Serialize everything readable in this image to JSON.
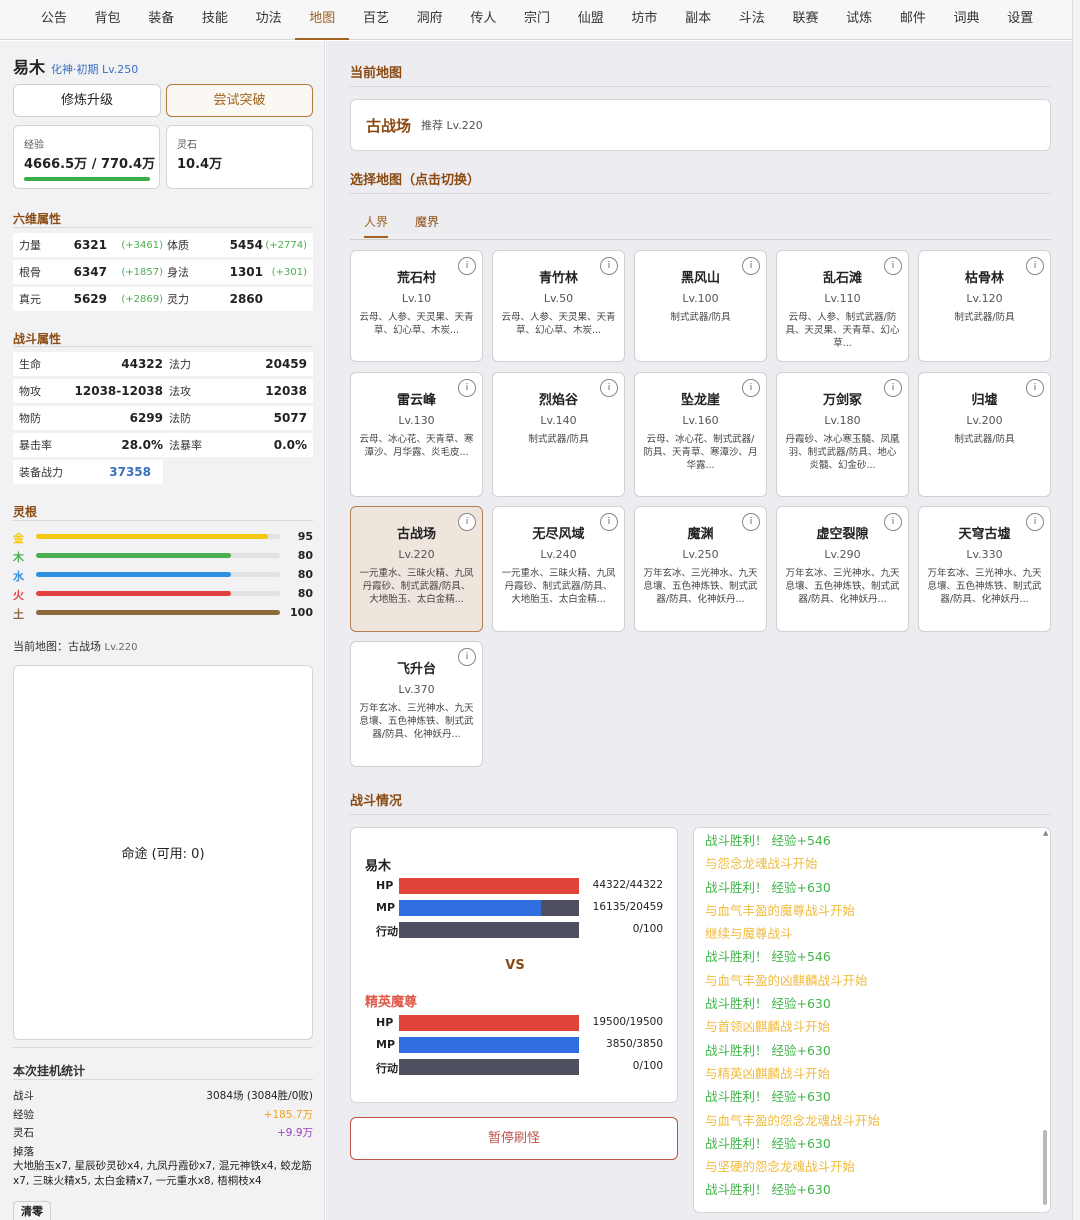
{
  "nav": [
    "公告",
    "背包",
    "装备",
    "技能",
    "功法",
    "地图",
    "百艺",
    "洞府",
    "传人",
    "宗门",
    "仙盟",
    "坊市",
    "副本",
    "斗法",
    "联赛",
    "试炼",
    "邮件",
    "词典",
    "设置"
  ],
  "nav_active": 5,
  "player": {
    "name": "易木",
    "realm": "化神·初期 Lv.250"
  },
  "buttons": {
    "cultivate": "修炼升级",
    "breakthrough": "尝试突破",
    "pause": "暂停刷怪",
    "clear": "清零"
  },
  "exp": {
    "label": "经验",
    "value": "4666.5万 / 770.4万",
    "progress": 1.0
  },
  "stone": {
    "label": "灵石",
    "value": "10.4万"
  },
  "six_attrs": {
    "title": "六维属性",
    "rows": [
      {
        "l1": "力量",
        "v1": "6321",
        "b1": "(+3461)",
        "l2": "体质",
        "v2": "5454",
        "b2": "(+2774)"
      },
      {
        "l1": "根骨",
        "v1": "6347",
        "b1": "(+1857)",
        "l2": "身法",
        "v2": "1301",
        "b2": "(+301)"
      },
      {
        "l1": "真元",
        "v1": "5629",
        "b1": "(+2869)",
        "l2": "灵力",
        "v2": "2860",
        "b2": ""
      }
    ]
  },
  "combat_attrs": {
    "title": "战斗属性",
    "rows": [
      {
        "l1": "生命",
        "v1": "44322",
        "l2": "法力",
        "v2": "20459"
      },
      {
        "l1": "物攻",
        "v1": "12038-12038",
        "l2": "法攻",
        "v2": "12038"
      },
      {
        "l1": "物防",
        "v1": "6299",
        "l2": "法防",
        "v2": "5077"
      },
      {
        "l1": "暴击率",
        "v1": "28.0%",
        "l2": "法暴率",
        "v2": "0.0%"
      }
    ],
    "power_label": "装备战力",
    "power": "37358"
  },
  "roots": {
    "title": "灵根",
    "items": [
      {
        "name": "金",
        "value": 95,
        "color": "#f2c80f"
      },
      {
        "name": "木",
        "value": 80,
        "color": "#4caf50"
      },
      {
        "name": "水",
        "value": 80,
        "color": "#2f8fe0"
      },
      {
        "name": "火",
        "value": 80,
        "color": "#e04040"
      },
      {
        "name": "土",
        "value": 100,
        "color": "#8a6a3a"
      }
    ],
    "max": 100
  },
  "current_map_line": {
    "label": "当前地图：古战场",
    "lv": "Lv.220"
  },
  "fate": "命途 (可用: 0)",
  "stats": {
    "title": "本次挂机统计",
    "battle_label": "战斗",
    "battle_value": "3084场 (3084胜/0败)",
    "exp_label": "经验",
    "exp_value": "+185.7万",
    "stone_label": "灵石",
    "stone_value": "+9.9万",
    "drop_label": "掉落",
    "drops": "大地胎玉x7, 星辰砂灵砂x4, 九凤丹霞砂x7, 混元神铁x4, 蛟龙筋x7, 三昧火精x5, 太白金精x7, 一元重水x8, 梧桐枝x4"
  },
  "current_map": {
    "section": "当前地图",
    "name": "古战场",
    "rec": "推荐 Lv.220"
  },
  "select": {
    "section": "选择地图（点击切换）",
    "tabs": [
      "人界",
      "魔界"
    ]
  },
  "maps": [
    {
      "name": "荒石村",
      "lv": "Lv.10",
      "drops": "云母、人参、天灵果、天青草、幻心草、木炭..."
    },
    {
      "name": "青竹林",
      "lv": "Lv.50",
      "drops": "云母、人参、天灵果、天青草、幻心草、木炭..."
    },
    {
      "name": "黑风山",
      "lv": "Lv.100",
      "drops": "制式武器/防具"
    },
    {
      "name": "乱石滩",
      "lv": "Lv.110",
      "drops": "云母、人参、制式武器/防具、天灵果、天青草、幻心草..."
    },
    {
      "name": "枯骨林",
      "lv": "Lv.120",
      "drops": "制式武器/防具"
    },
    {
      "name": "雷云峰",
      "lv": "Lv.130",
      "drops": "云母、冰心花、天青草、寒潭沙、月华露、炎毛皮..."
    },
    {
      "name": "烈焰谷",
      "lv": "Lv.140",
      "drops": "制式武器/防具"
    },
    {
      "name": "坠龙崖",
      "lv": "Lv.160",
      "drops": "云母、冰心花、制式武器/防具、天青草、寒潭沙、月华露..."
    },
    {
      "name": "万剑冢",
      "lv": "Lv.180",
      "drops": "丹霞砂、冰心寒玉髓、凤凰羽、制式武器/防具、地心炎髓、幻金砂..."
    },
    {
      "name": "归墟",
      "lv": "Lv.200",
      "drops": "制式武器/防具"
    },
    {
      "name": "古战场",
      "lv": "Lv.220",
      "drops": "一元重水、三昧火精、九凤丹霞砂、制式武器/防具、大地胎玉、太白金精..."
    },
    {
      "name": "无尽风域",
      "lv": "Lv.240",
      "drops": "一元重水、三昧火精、九凤丹霞砂、制式武器/防具、大地胎玉、太白金精..."
    },
    {
      "name": "魔渊",
      "lv": "Lv.250",
      "drops": "万年玄冰、三光神水、九天息壤、五色神炼铁、制式武器/防具、化神妖丹..."
    },
    {
      "name": "虚空裂隙",
      "lv": "Lv.290",
      "drops": "万年玄冰、三光神水、九天息壤、五色神炼铁、制式武器/防具、化神妖丹..."
    },
    {
      "name": "天穹古墟",
      "lv": "Lv.330",
      "drops": "万年玄冰、三光神水、九天息壤、五色神炼铁、制式武器/防具、化神妖丹..."
    },
    {
      "name": "飞升台",
      "lv": "Lv.370",
      "drops": "万年玄冰、三光神水、九天息壤、五色神炼铁、制式武器/防具、化神妖丹..."
    }
  ],
  "selected_map": 10,
  "info_glyph": "i",
  "battle": {
    "section": "战斗情况",
    "vs": "VS",
    "player": {
      "name": "易木",
      "hp": "44322/44322",
      "mp": "16135/20459",
      "act": "0/100",
      "hp_frac": 1.0,
      "mp_frac": 0.79,
      "act_frac": 0
    },
    "enemy": {
      "name": "精英魔尊",
      "hp": "19500/19500",
      "mp": "3850/3850",
      "act": "0/100",
      "hp_frac": 1.0,
      "mp_frac": 1.0,
      "act_frac": 0
    },
    "labels": {
      "hp": "HP",
      "mp": "MP",
      "act": "行动"
    }
  },
  "log": [
    {
      "t": "战斗胜利！ 经验+546",
      "k": "win"
    },
    {
      "t": "与怨念龙魂战斗开始",
      "k": "start"
    },
    {
      "t": "战斗胜利！ 经验+630",
      "k": "win"
    },
    {
      "t": "与血气丰盈的魔尊战斗开始",
      "k": "start"
    },
    {
      "t": "继续与魔尊战斗",
      "k": "start"
    },
    {
      "t": "战斗胜利！ 经验+546",
      "k": "win"
    },
    {
      "t": "与血气丰盈的凶麒麟战斗开始",
      "k": "start"
    },
    {
      "t": "战斗胜利！ 经验+630",
      "k": "win"
    },
    {
      "t": "与首领凶麒麟战斗开始",
      "k": "start"
    },
    {
      "t": "战斗胜利！ 经验+630",
      "k": "win"
    },
    {
      "t": "与精英凶麒麟战斗开始",
      "k": "start"
    },
    {
      "t": "战斗胜利！ 经验+630",
      "k": "win"
    },
    {
      "t": "与血气丰盈的怨念龙魂战斗开始",
      "k": "start"
    },
    {
      "t": "战斗胜利！ 经验+630",
      "k": "win"
    },
    {
      "t": "与坚硬的怨念龙魂战斗开始",
      "k": "start"
    },
    {
      "t": "战斗胜利！ 经验+630",
      "k": "win"
    }
  ]
}
